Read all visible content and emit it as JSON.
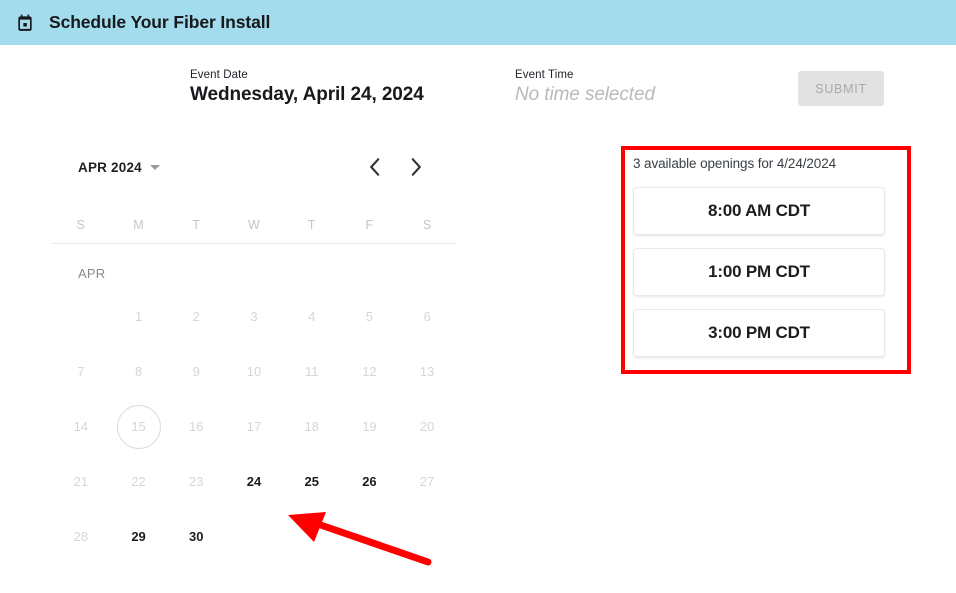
{
  "header": {
    "icon": "calendar-today-icon",
    "title": "Schedule Your Fiber Install",
    "background_color": "#a3dcec"
  },
  "summary": {
    "event_date_caption": "Event Date",
    "event_date_value": "Wednesday, April 24, 2024",
    "event_time_caption": "Event Time",
    "event_time_value": "No time selected",
    "submit_label": "SUBMIT",
    "submit_disabled": true
  },
  "calendar": {
    "month_select_label": "APR 2024",
    "caret_icon": "chevron-down-icon",
    "prev_icon": "chevron-left-icon",
    "next_icon": "chevron-right-icon",
    "prev_label": "‹",
    "next_label": "›",
    "weekdays": [
      "S",
      "M",
      "T",
      "W",
      "T",
      "F",
      "S"
    ],
    "month_sublabel": "APR",
    "leading_blanks": 1,
    "days": [
      {
        "num": "1",
        "state": "disabled"
      },
      {
        "num": "2",
        "state": "disabled"
      },
      {
        "num": "3",
        "state": "disabled"
      },
      {
        "num": "4",
        "state": "disabled"
      },
      {
        "num": "5",
        "state": "disabled"
      },
      {
        "num": "6",
        "state": "disabled"
      },
      {
        "num": "7",
        "state": "disabled"
      },
      {
        "num": "8",
        "state": "disabled"
      },
      {
        "num": "9",
        "state": "disabled"
      },
      {
        "num": "10",
        "state": "disabled"
      },
      {
        "num": "11",
        "state": "disabled"
      },
      {
        "num": "12",
        "state": "disabled"
      },
      {
        "num": "13",
        "state": "disabled"
      },
      {
        "num": "14",
        "state": "disabled"
      },
      {
        "num": "15",
        "state": "today"
      },
      {
        "num": "16",
        "state": "disabled"
      },
      {
        "num": "17",
        "state": "disabled"
      },
      {
        "num": "18",
        "state": "disabled"
      },
      {
        "num": "19",
        "state": "disabled"
      },
      {
        "num": "20",
        "state": "disabled"
      },
      {
        "num": "21",
        "state": "disabled"
      },
      {
        "num": "22",
        "state": "disabled"
      },
      {
        "num": "23",
        "state": "disabled"
      },
      {
        "num": "24",
        "state": "enabled"
      },
      {
        "num": "25",
        "state": "enabled"
      },
      {
        "num": "26",
        "state": "enabled"
      },
      {
        "num": "27",
        "state": "disabled"
      },
      {
        "num": "28",
        "state": "disabled"
      },
      {
        "num": "29",
        "state": "enabled"
      },
      {
        "num": "30",
        "state": "enabled"
      }
    ]
  },
  "openings": {
    "caption": "3 available openings for 4/24/2024",
    "count": 3,
    "for_date": "4/24/2024",
    "slots": [
      {
        "label": "8:00 AM CDT"
      },
      {
        "label": "1:00 PM CDT"
      },
      {
        "label": "3:00 PM CDT"
      }
    ]
  },
  "annotations": {
    "highlight_box_color": "#ff0000",
    "arrow_color": "#ff0000"
  }
}
